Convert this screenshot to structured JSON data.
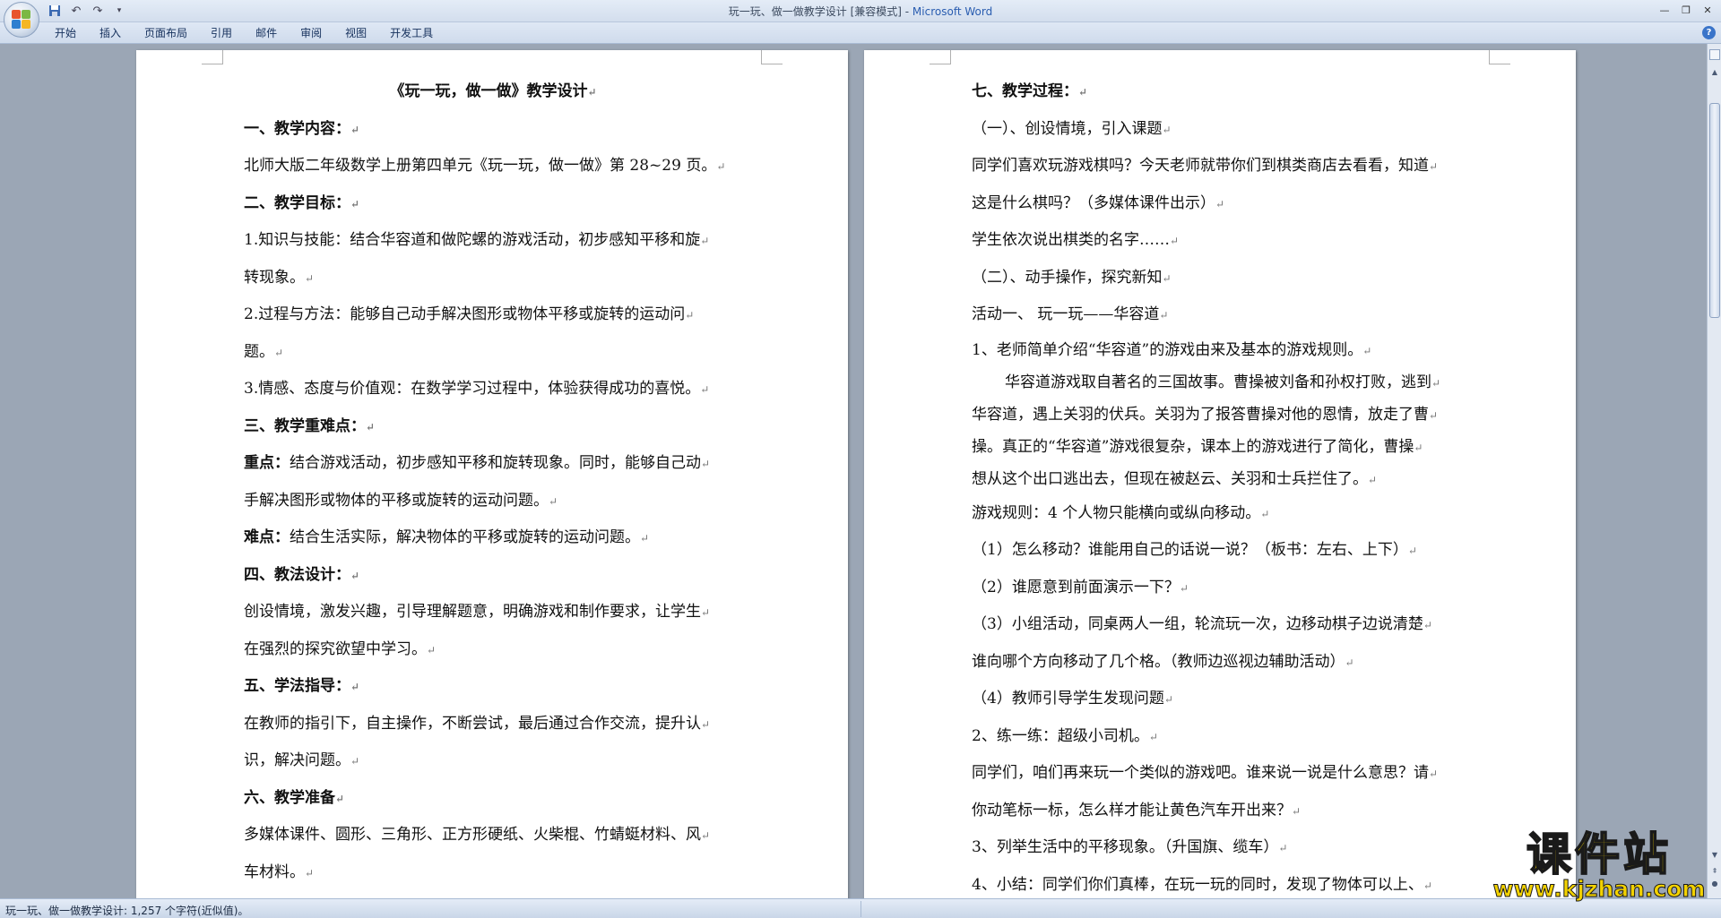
{
  "window": {
    "title": "玩一玩、做一做教学设计 [兼容模式] - ",
    "app_name": "Microsoft Word"
  },
  "quick_access": [
    "save-icon",
    "undo-icon",
    "redo-icon",
    "customize-icon"
  ],
  "ribbon": {
    "tabs": [
      "开始",
      "插入",
      "页面布局",
      "引用",
      "邮件",
      "审阅",
      "视图",
      "开发工具"
    ]
  },
  "page_left": {
    "lines": [
      {
        "text": "《玩一玩，做一做》教学设计",
        "style": "b center"
      },
      {
        "text": "一、教学内容：",
        "style": "b"
      },
      {
        "text": "  北师大版二年级数学上册第四单元《玩一玩，做一做》第 28~29 页。",
        "style": ""
      },
      {
        "text": "二、教学目标：",
        "style": "b"
      },
      {
        "text": "1.知识与技能：结合华容道和做陀螺的游戏活动，初步感知平移和旋",
        "style": ""
      },
      {
        "text": "转现象。",
        "style": ""
      },
      {
        "text": "2.过程与方法：能够自己动手解决图形或物体平移或旋转的运动问",
        "style": ""
      },
      {
        "text": "题。",
        "style": ""
      },
      {
        "text": "3.情感、态度与价值观：在数学学习过程中，体验获得成功的喜悦。",
        "style": ""
      },
      {
        "text": "三、教学重难点：",
        "style": "b"
      },
      {
        "label": "重点：",
        "text": "结合游戏活动，初步感知平移和旋转现象。同时，能够自己动",
        "style": ""
      },
      {
        "text": "手解决图形或物体的平移或旋转的运动问题。",
        "style": ""
      },
      {
        "label": "难点：",
        "text": "结合生活实际，解决物体的平移或旋转的运动问题。",
        "style": ""
      },
      {
        "text": "四、教法设计：",
        "style": "b"
      },
      {
        "text": "创设情境，激发兴趣，引导理解题意，明确游戏和制作要求，让学生",
        "style": ""
      },
      {
        "text": "在强烈的探究欲望中学习。",
        "style": ""
      },
      {
        "text": "五、学法指导：",
        "style": "b"
      },
      {
        "text": "在教师的指引下，自主操作，不断尝试，最后通过合作交流，提升认",
        "style": ""
      },
      {
        "text": "识，解决问题。",
        "style": ""
      },
      {
        "text": "六、教学准备",
        "style": "b"
      },
      {
        "text": "多媒体课件、圆形、三角形、正方形硬纸、火柴棍、竹蜻蜓材料、风",
        "style": ""
      },
      {
        "text": "车材料。",
        "style": ""
      }
    ]
  },
  "page_right": {
    "lines": [
      {
        "text": "七、教学过程：",
        "style": "b"
      },
      {
        "text": "（一）、创设情境，引入课题",
        "style": ""
      },
      {
        "text": "同学们喜欢玩游戏棋吗？今天老师就带你们到棋类商店去看看，知道",
        "style": ""
      },
      {
        "text": "这是什么棋吗？（多媒体课件出示）",
        "style": ""
      },
      {
        "text": "学生依次说出棋类的名字……",
        "style": ""
      },
      {
        "text": "（二）、动手操作，探究新知",
        "style": ""
      },
      {
        "text": "活动一、   玩一玩——华容道",
        "style": ""
      },
      {
        "text": "1、老师简单介绍“华容道”的游戏由来及基本的游戏规则。",
        "style": "sm"
      },
      {
        "text": "华容道游戏取自著名的三国故事。曹操被刘备和孙权打败，逃到",
        "style": "sm indent"
      },
      {
        "text": "华容道，遇上关羽的伏兵。关羽为了报答曹操对他的恩情，放走了曹",
        "style": "sm"
      },
      {
        "text": "操。真正的“华容道”游戏很复杂，课本上的游戏进行了简化，曹操",
        "style": "sm"
      },
      {
        "text": "想从这个出口逃出去，但现在被赵云、关羽和士兵拦住了。",
        "style": "sm"
      },
      {
        "text": "游戏规则：4 个人物只能横向或纵向移动。",
        "style": ""
      },
      {
        "text": "（1）怎么移动？谁能用自己的话说一说？（板书：左右、上下）",
        "style": ""
      },
      {
        "text": "（2）谁愿意到前面演示一下？",
        "style": ""
      },
      {
        "text": "（3）小组活动，同桌两人一组，轮流玩一次，边移动棋子边说清楚",
        "style": ""
      },
      {
        "text": "谁向哪个方向移动了几个格。（教师边巡视边辅助活动）",
        "style": ""
      },
      {
        "text": "（4）教师引导学生发现问题",
        "style": ""
      },
      {
        "text": "2、练一练：超级小司机。",
        "style": ""
      },
      {
        "text": "同学们，咱们再来玩一个类似的游戏吧。谁来说一说是什么意思？请",
        "style": ""
      },
      {
        "text": "你动笔标一标，怎么样才能让黄色汽车开出来？",
        "style": ""
      },
      {
        "text": "3、列举生活中的平移现象。（升国旗、缆车）",
        "style": ""
      },
      {
        "text": "4、小结：同学们你们真棒，在玩一玩的同时，发现了物体可以上、",
        "style": ""
      }
    ]
  },
  "paragraph_mark": "↵",
  "status": {
    "text": "玩一玩、做一做教学设计: 1,257 个字符(近似值)。"
  },
  "watermark": {
    "title": "课件站",
    "url": "www.kjzhan.com"
  }
}
